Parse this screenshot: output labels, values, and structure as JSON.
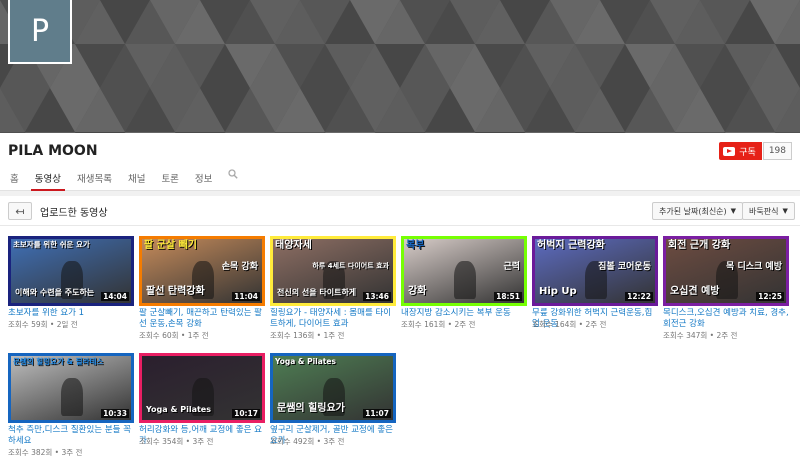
{
  "banner": {
    "avatar_letter": "P"
  },
  "channel": {
    "name": "PILA MOON",
    "subscribe_label": "구독",
    "subscriber_count": "198"
  },
  "tabs": [
    {
      "label": "홈",
      "active": false
    },
    {
      "label": "동영상",
      "active": true
    },
    {
      "label": "재생목록",
      "active": false
    },
    {
      "label": "채널",
      "active": false
    },
    {
      "label": "토론",
      "active": false
    },
    {
      "label": "정보",
      "active": false
    }
  ],
  "toolbar": {
    "back_icon": "back-arrow-icon",
    "section_title": "업로드한 동영상",
    "sort_label": "추가된 날짜(최신순)",
    "view_label": "바둑판식"
  },
  "videos": [
    {
      "title": "초보자를 위한 요가 1",
      "meta": "조회수 59회 • 2일 전",
      "duration": "14:04",
      "caption_top": "초보자를 위한 쉬운 요가",
      "caption_bottom": "이해와 수련을 주도하는",
      "frame": "#1a237e",
      "bg": "#3f6fb5"
    },
    {
      "title": "팔 군살빼기, 매끈하고 탄력있는 팔 선 운동,손목 강화",
      "meta": "조회수 60회 • 1주 전",
      "duration": "11:04",
      "caption_top": "팔 군살 빼기",
      "caption_mid": "손목 강화",
      "caption_bottom": "팔선 탄력강화",
      "frame": "#f57c00",
      "bg": "#c48a5a"
    },
    {
      "title": "힐링요가 - 태양자세 : 몸매를 타이트하게, 다이어트 효과",
      "meta": "조회수 136회 • 1주 전",
      "duration": "13:46",
      "caption_top": "태양자세",
      "caption_mid": "하루 4세트 다이어트 효과",
      "caption_bottom": "전신의 선을 타이트하게",
      "frame": "#ffeb3b",
      "bg": "#8d6e63"
    },
    {
      "title": "내장지방 감소시키는 복부 운동",
      "meta": "조회수 161회 • 2주 전",
      "duration": "18:51",
      "caption_top": "복부",
      "caption_mid": "근력",
      "caption_bottom": "강화",
      "frame": "#76ff03",
      "bg": "#d7ccc8"
    },
    {
      "title": "무릎 강화위한 허벅지 근력운동,힙업 운동",
      "meta": "조회수 164회 • 2주 전",
      "duration": "12:22",
      "caption_top": "허벅지 근력강화",
      "caption_mid": "짐볼 코어운동",
      "caption_bottom": "Hip Up",
      "frame": "#6a1b9a",
      "bg": "#5c6bc0"
    },
    {
      "title": "목디스크,오십견 예방과 치료, 경추,회전근 강화",
      "meta": "조회수 347회 • 2주 전",
      "duration": "12:25",
      "caption_top": "회전 근개 강화",
      "caption_mid": "목 디스크 예방",
      "caption_bottom": "오십견 예방",
      "frame": "#7b1fa2",
      "bg": "#6d4c41"
    },
    {
      "title": "척추 측만,디스크 질환있는 분들 꼭 하세요",
      "meta": "조회수 382회 • 3주 전",
      "duration": "10:33",
      "caption_top": "문쌤의 힐링요가 & 필라테스",
      "frame": "#1565c0",
      "bg": "#bdbdbd"
    },
    {
      "title": "허리강화와 등,어깨 교정에 좋은 요가",
      "meta": "조회수 354회 • 3주 전",
      "duration": "10:17",
      "caption_bottom": "Yoga & Pilates",
      "frame": "#e91e63",
      "bg": "#2b1f2e"
    },
    {
      "title": "옆구리 군살제거, 골반 교정에 좋은 요가",
      "meta": "조회수 492회 • 3주 전",
      "duration": "11:07",
      "caption_top": "Yoga & Pilates",
      "caption_bottom": "문쌤의 힐링요가",
      "frame": "#1565c0",
      "bg": "#4e7d53"
    }
  ],
  "colors": {
    "accent_red": "#cc181e",
    "subscribe_red": "#e62117",
    "link_blue": "#167ac6"
  }
}
